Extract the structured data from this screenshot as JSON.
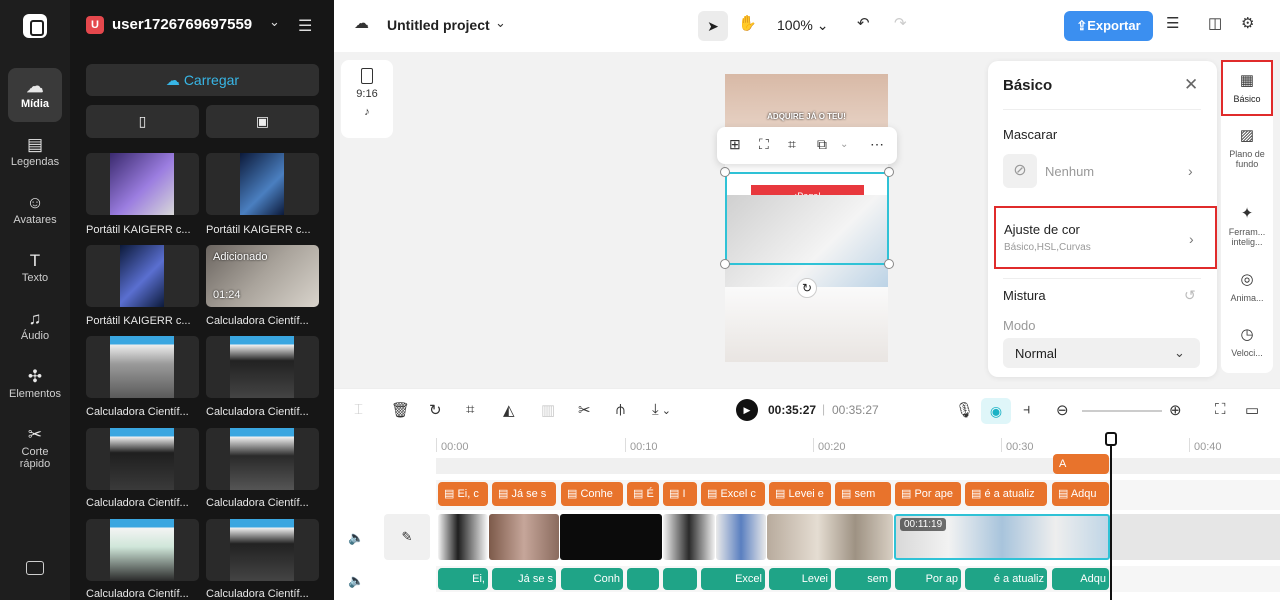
{
  "rail": {
    "items": [
      {
        "label": "Mídia",
        "icon": "cloud-icon"
      },
      {
        "label": "Legendas",
        "icon": "captions-icon"
      },
      {
        "label": "Avatares",
        "icon": "avatar-icon"
      },
      {
        "label": "Texto",
        "icon": "text-icon"
      },
      {
        "label": "Áudio",
        "icon": "music-icon"
      },
      {
        "label": "Elementos",
        "icon": "elements-icon"
      },
      {
        "label": "Corte rápido",
        "icon": "scissors-icon"
      }
    ]
  },
  "media": {
    "user_initial": "U",
    "user_name": "user1726769697559",
    "upload_label": "Carregar",
    "items": [
      {
        "label": "Portátil KAIGERR c...",
        "overlay": "",
        "duration": ""
      },
      {
        "label": "Portátil KAIGERR c...",
        "overlay": "",
        "duration": ""
      },
      {
        "label": "Portátil KAIGERR c...",
        "overlay": "",
        "duration": ""
      },
      {
        "label": "Calculadora Científ...",
        "overlay": "Adicionado",
        "duration": "01:24"
      },
      {
        "label": "Calculadora Científ...",
        "overlay": "",
        "duration": ""
      },
      {
        "label": "Calculadora Científ...",
        "overlay": "",
        "duration": ""
      },
      {
        "label": "Calculadora Científ...",
        "overlay": "",
        "duration": ""
      },
      {
        "label": "Calculadora Científ...",
        "overlay": "",
        "duration": ""
      },
      {
        "label": "Calculadora Científ...",
        "overlay": "",
        "duration": ""
      },
      {
        "label": "Calculadora Científ...",
        "overlay": "",
        "duration": ""
      }
    ]
  },
  "topbar": {
    "project_title": "Untitled project",
    "zoom": "100%",
    "export_label": "Exportar"
  },
  "canvas": {
    "ratio": "9:16",
    "banner_text": "ADQUIRE JÁ O TEU!",
    "red_text": "¡Pega!"
  },
  "basic_panel": {
    "title": "Básico",
    "mask_heading": "Mascarar",
    "mask_value": "Nenhum",
    "color_heading": "Ajuste de cor",
    "color_sub": "Básico,HSL,Curvas",
    "blend_heading": "Mistura",
    "mode_label": "Modo",
    "mode_value": "Normal"
  },
  "right_tools": [
    {
      "label": "Básico",
      "icon": "basic-icon"
    },
    {
      "label": "Plano de fundo",
      "icon": "background-icon"
    },
    {
      "label": "Ferram... intelig...",
      "icon": "magic-wand-icon"
    },
    {
      "label": "Anima...",
      "icon": "animation-icon"
    },
    {
      "label": "Veloci...",
      "icon": "speed-icon"
    }
  ],
  "timeline": {
    "current_time": "00:35:27",
    "total_time": "00:35:27",
    "ruler": [
      "00:00",
      "00:10",
      "00:20",
      "00:30",
      "00:40"
    ],
    "caption_clips": [
      "Ei, c",
      "Já se s",
      "Conhe",
      "É",
      "I",
      "Excel c",
      "Levei e",
      "sem",
      "Por ape",
      "é a atualiz",
      "Adqu"
    ],
    "audio_clips": [
      "Ei,",
      "Já se s",
      "Conh",
      "",
      "",
      "Excel",
      "Levei",
      "sem",
      "Por ap",
      "é a atualiz",
      "Adqu"
    ],
    "selected_duration": "00:11:19",
    "text_clip_letter": "A"
  },
  "colors": {
    "accent": "#3b8ff0",
    "selection": "#2fc2d6",
    "highlight": "#e02b2b",
    "caption": "#e8732c",
    "audio": "#1fa487"
  }
}
